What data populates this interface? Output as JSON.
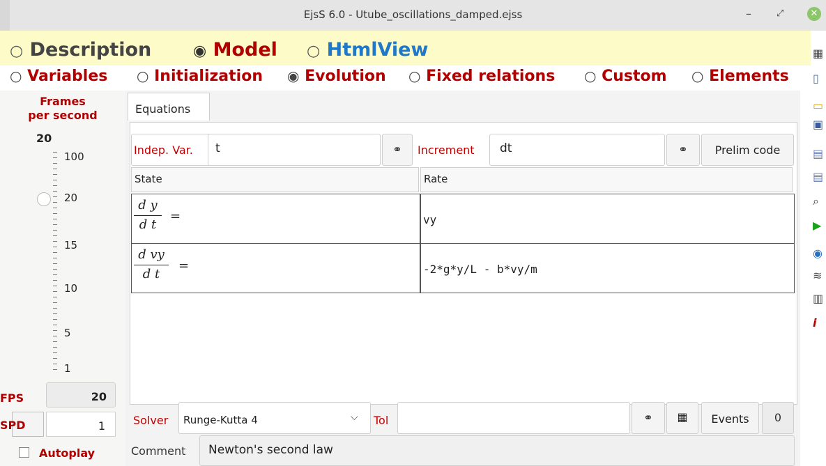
{
  "window": {
    "title": "EjsS 6.0 - Utube_oscillations_damped.ejss",
    "minimize_glyph": "–",
    "restore_glyph": "⤢",
    "close_glyph": "✕"
  },
  "main_tabs": {
    "radio_unselected": "○",
    "radio_selected": "◉",
    "description": "Description",
    "model": "Model",
    "htmlview": "HtmlView"
  },
  "sub_tabs": {
    "variables": "Variables",
    "initialization": "Initialization",
    "evolution": "Evolution",
    "fixed_relations": "Fixed relations",
    "custom": "Custom",
    "elements": "Elements"
  },
  "left_panel": {
    "frames_label_1": "Frames",
    "frames_label_2": "per second",
    "current_value": "20",
    "tick_labels": [
      "100",
      "20",
      "15",
      "10",
      "5",
      "1"
    ],
    "slider_value": "20",
    "fps_label": "FPS",
    "fps_value": "20",
    "spd_label": "SPD",
    "spd_value": "1",
    "autoplay_label": "Autoplay",
    "autoplay_checked": false
  },
  "equations": {
    "tab_label": "Equations",
    "indep_var_label": "Indep. Var.",
    "indep_var_value": "t",
    "increment_label": "Increment",
    "increment_value": "dt",
    "prelim_button": "Prelim code",
    "state_header": "State",
    "rate_header": "Rate",
    "rows": [
      {
        "num": "d y",
        "den": "d t",
        "eq": "=",
        "rate": "vy"
      },
      {
        "num": "d vy",
        "den": "d t",
        "eq": "=",
        "rate": "-2*g*y/L - b*vy/m"
      }
    ],
    "solver_label": "Solver",
    "solver_value": "Runge-Kutta 4",
    "tol_label": "Tol",
    "tol_value": "",
    "events_button": "Events",
    "events_count": "0",
    "comment_label": "Comment",
    "comment_value": "Newton's second law"
  },
  "colors": {
    "accent_red": "#b00000",
    "accent_blue": "#1f78c8",
    "tab_bar_bg": "#fdfbc8"
  },
  "icons": [
    "link-icon",
    "table-icon",
    "new-file-icon",
    "open-folder-icon",
    "computer-icon",
    "save-icon",
    "save-as-icon",
    "search-icon",
    "run-icon",
    "web-icon",
    "stack-icon",
    "clipboard-icon",
    "info-icon"
  ]
}
